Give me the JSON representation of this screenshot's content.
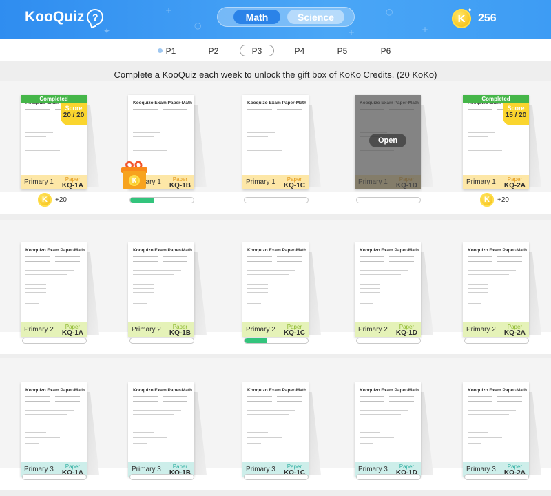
{
  "app": {
    "logo_text": "KooQuiz",
    "logo_badge": "?",
    "coins": "256",
    "coin_letter": "K"
  },
  "subjects": [
    {
      "label": "Math",
      "active": true
    },
    {
      "label": "Science",
      "active": false
    }
  ],
  "levels": [
    "P1",
    "P2",
    "P3",
    "P4",
    "P5",
    "P6"
  ],
  "active_level": "P3",
  "notice": "Complete a KooQuiz each week to unlock the gift box of KoKo Credits. (20 KoKo)",
  "paper_title": "Kooquizo Exam Paper-Math",
  "paper_label": "Paper",
  "completed_label": "Completed",
  "score_label": "Score",
  "open_label": "Open",
  "rows": [
    {
      "primary": "Primary 1",
      "theme": "p1",
      "cards": [
        {
          "code": "KQ-1A",
          "status": "completed",
          "score": "20 / 20",
          "reward": "+20"
        },
        {
          "code": "KQ-1B",
          "status": "in-progress",
          "progress": 0.38,
          "gift": true
        },
        {
          "code": "KQ-1C",
          "status": "new",
          "progress": 0
        },
        {
          "code": "KQ-1D",
          "status": "locked",
          "progress": 0
        },
        {
          "code": "KQ-2A",
          "status": "completed",
          "score": "15 / 20",
          "reward": "+20"
        }
      ]
    },
    {
      "primary": "Primary 2",
      "theme": "p2",
      "cards": [
        {
          "code": "KQ-1A",
          "status": "new",
          "progress": 0
        },
        {
          "code": "KQ-1B",
          "status": "new",
          "progress": 0
        },
        {
          "code": "KQ-1C",
          "status": "in-progress",
          "progress": 0.36
        },
        {
          "code": "KQ-1D",
          "status": "new",
          "progress": 0
        },
        {
          "code": "KQ-2A",
          "status": "new",
          "progress": 0
        }
      ]
    },
    {
      "primary": "Primary 3",
      "theme": "p3",
      "cards": [
        {
          "code": "KQ-1A",
          "status": "new",
          "progress": 0
        },
        {
          "code": "KQ-1B",
          "status": "new",
          "progress": 0
        },
        {
          "code": "KQ-1C",
          "status": "new",
          "progress": 0
        },
        {
          "code": "KQ-1D",
          "status": "new",
          "progress": 0
        },
        {
          "code": "KQ-2A",
          "status": "new",
          "progress": 0
        }
      ]
    }
  ],
  "colors": {
    "header": "#3a98f3",
    "completed": "#45b649",
    "score": "#fad52e",
    "progress": "#33c47c"
  }
}
